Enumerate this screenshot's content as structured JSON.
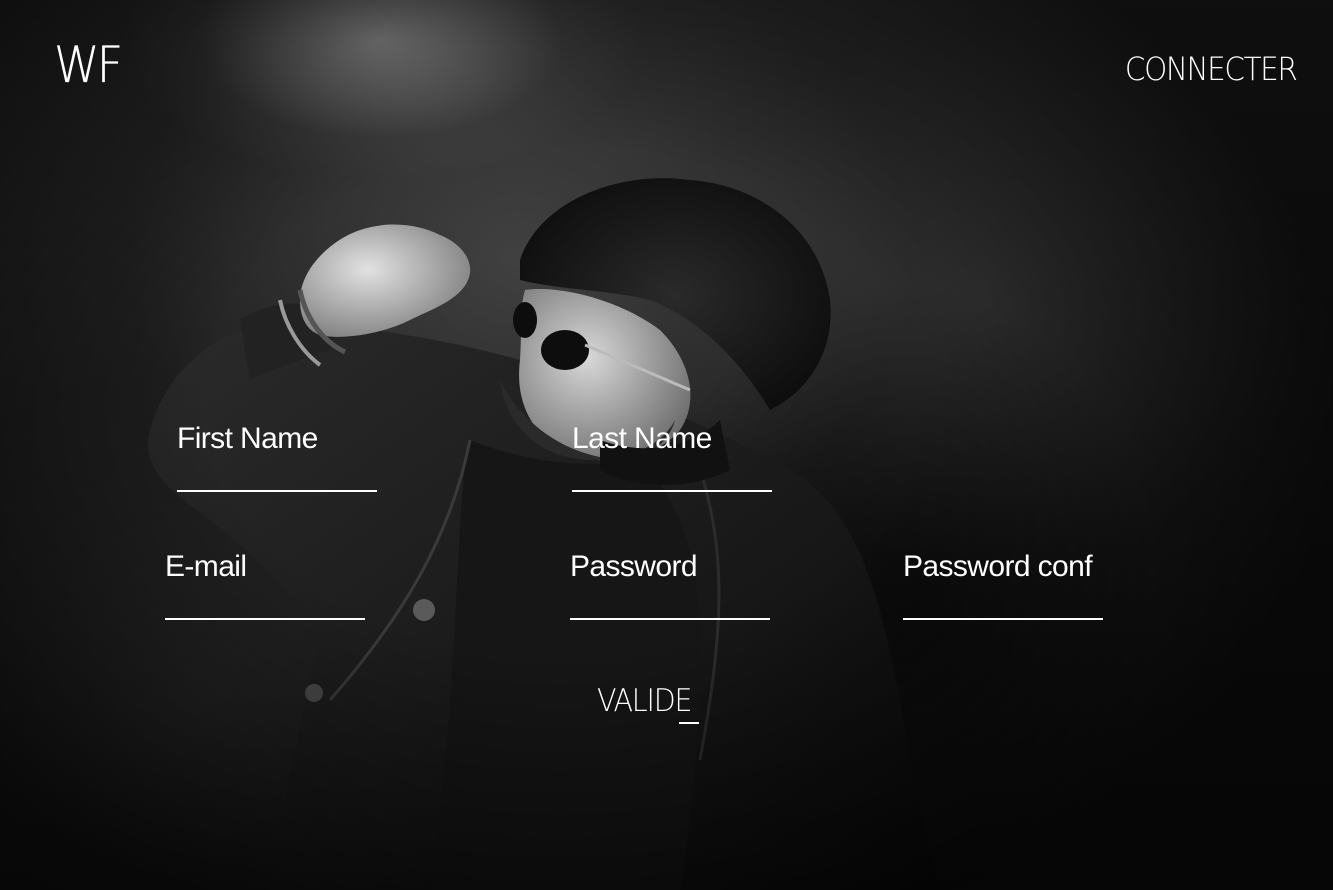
{
  "brand": {
    "logo_text": "WF"
  },
  "header": {
    "login_link": "CONNECTER"
  },
  "form": {
    "first_name_label": "First Name",
    "last_name_label": "Last Name",
    "email_label": "E-mail",
    "password_label": "Password",
    "password_confirm_label": "Password conf",
    "submit_label": "VALIDE"
  },
  "colors": {
    "text": "#ffffff",
    "background": "#1a1a1a"
  }
}
